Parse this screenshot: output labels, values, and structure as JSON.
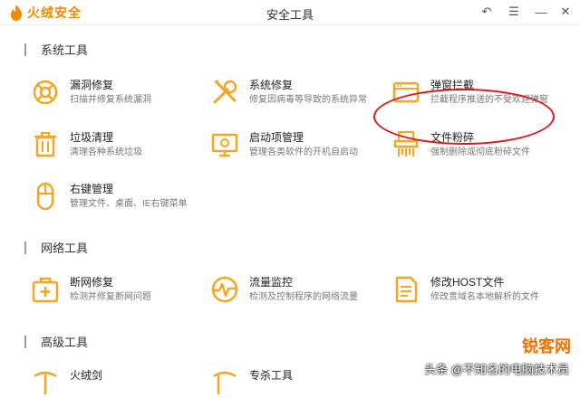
{
  "app": {
    "logo_text": "火绒安全",
    "window_title": "安全工具"
  },
  "window_controls": {
    "back": "↶",
    "menu": "☰",
    "minimize": "—",
    "close": "✕"
  },
  "sections": {
    "system": "系统工具",
    "network": "网络工具",
    "advanced": "高级工具"
  },
  "tools": {
    "vuln_repair": {
      "name": "漏洞修复",
      "desc": "扫描并修复系统漏洞",
      "icon": "lifebuoy-icon"
    },
    "sys_repair": {
      "name": "系统修复",
      "desc": "修复因病毒等导致的系统异常",
      "icon": "wrench-screwdriver-icon"
    },
    "popup_block": {
      "name": "弹窗拦截",
      "desc": "拦截程序推送的不受欢迎弹窗",
      "icon": "window-icon"
    },
    "junk_clean": {
      "name": "垃圾清理",
      "desc": "清理各种系统垃圾",
      "icon": "trash-icon"
    },
    "startup_mgr": {
      "name": "启动项管理",
      "desc": "管理各类软件的开机自启动",
      "icon": "monitor-icon"
    },
    "file_shred": {
      "name": "文件粉碎",
      "desc": "强制删除或彻底粉碎文件",
      "icon": "shredder-icon"
    },
    "rclick_mgr": {
      "name": "右键管理",
      "desc": "管理文件、桌面、IE右键菜单",
      "icon": "mouse-icon"
    },
    "net_repair": {
      "name": "断网修复",
      "desc": "检测并修复断网问题",
      "icon": "first-aid-icon"
    },
    "traffic_mon": {
      "name": "流量监控",
      "desc": "检测及控制程序的网络流量",
      "icon": "pulse-icon"
    },
    "host_edit": {
      "name": "修改HOST文件",
      "desc": "修改贵域名本地解析的文件",
      "icon": "document-icon"
    },
    "adv1": {
      "name": "火绒剑",
      "desc": "",
      "icon": "sword-icon"
    },
    "adv2": {
      "name": "专杀工具",
      "desc": "",
      "icon": "tool-icon"
    }
  },
  "watermark": {
    "text": "头条 @不知名的电脑技术员",
    "logo": "锐客网"
  },
  "colors": {
    "accent": "#f5a623",
    "annotation": "#d8171a"
  }
}
